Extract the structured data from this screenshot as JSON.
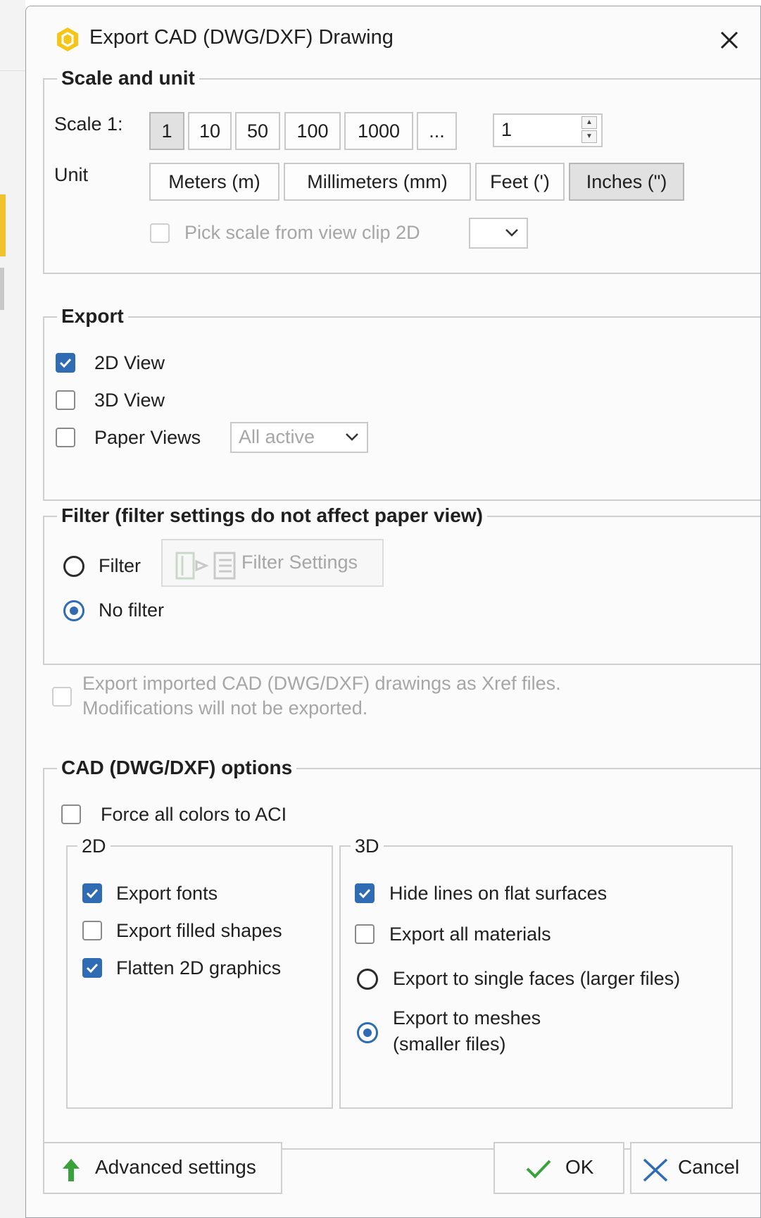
{
  "window": {
    "title": "Export CAD (DWG/DXF) Drawing"
  },
  "scale_unit": {
    "legend": "Scale and unit",
    "scale_label": "Scale 1:",
    "scale_buttons": [
      "1",
      "10",
      "50",
      "100",
      "1000",
      "..."
    ],
    "scale_selected": "1",
    "scale_value": "1",
    "unit_label": "Unit",
    "unit_buttons": [
      "Meters (m)",
      "Millimeters (mm)",
      "Feet (')",
      "Inches (\")"
    ],
    "unit_selected": "Inches (\")",
    "pick_scale_label": "Pick scale from view clip 2D",
    "pick_scale_checked": false,
    "pick_scale_enabled": false
  },
  "export": {
    "legend": "Export",
    "view_2d": {
      "label": "2D View",
      "checked": true
    },
    "view_3d": {
      "label": "3D View",
      "checked": false
    },
    "paper_views": {
      "label": "Paper Views",
      "checked": false,
      "dropdown_value": "All active"
    }
  },
  "filter": {
    "legend": "Filter (filter settings do not affect paper view)",
    "option_filter": {
      "label": "Filter",
      "selected": false
    },
    "filter_settings_button": "Filter Settings",
    "option_no_filter": {
      "label": "No filter",
      "selected": true
    }
  },
  "xref": {
    "label_line1": "Export imported CAD (DWG/DXF) drawings as Xref files.",
    "label_line2": "Modifications will not be exported.",
    "checked": false,
    "enabled": false
  },
  "cad_options": {
    "legend": "CAD (DWG/DXF) options",
    "force_aci": {
      "label": "Force all colors to ACI",
      "checked": false
    },
    "group_2d": {
      "legend": "2D",
      "export_fonts": {
        "label": "Export fonts",
        "checked": true
      },
      "export_filled_shapes": {
        "label": "Export filled shapes",
        "checked": false
      },
      "flatten_2d": {
        "label": "Flatten 2D graphics",
        "checked": true
      }
    },
    "group_3d": {
      "legend": "3D",
      "hide_lines": {
        "label": "Hide lines on flat surfaces",
        "checked": true
      },
      "export_materials": {
        "label": "Export all materials",
        "checked": false
      },
      "single_faces": {
        "label": "Export to single faces (larger files)",
        "selected": false
      },
      "meshes": {
        "label_line1": "Export to meshes",
        "label_line2": "(smaller files)",
        "selected": true
      }
    }
  },
  "footer": {
    "advanced_label": "Advanced settings",
    "ok_label": "OK",
    "cancel_label": "Cancel"
  },
  "colors": {
    "accent_blue": "#2f6cb3",
    "brand_yellow": "#f2c12e",
    "ok_green": "#3aa23a",
    "cancel_blue": "#2f6cb3"
  },
  "icons": {
    "app": "hexagon-app-icon",
    "close": "close-icon",
    "advanced": "green-up-arrow-icon",
    "ok": "checkmark-icon",
    "cancel": "x-cancel-icon",
    "filter_settings": "filter-settings-icon"
  }
}
